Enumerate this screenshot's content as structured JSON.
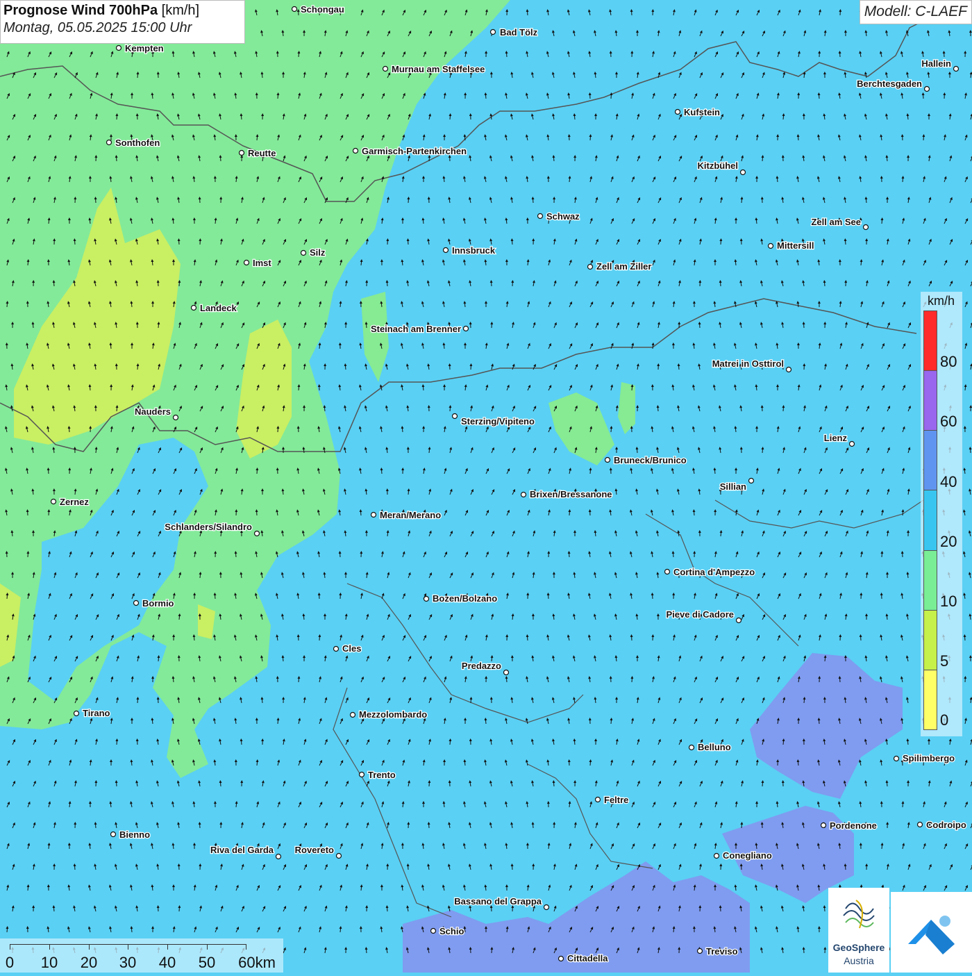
{
  "header": {
    "title_bold": "Prognose Wind 700hPa",
    "title_unit": "[km/h]",
    "datetime": "Montag, 05.05.2025 15:00 Uhr"
  },
  "model_label": "Modell: C-LAEF",
  "legend": {
    "unit": "km/h",
    "ticks": [
      "80",
      "60",
      "40",
      "20",
      "10",
      "5",
      "0"
    ],
    "colors": [
      "#ff2b2b",
      "#9966ee",
      "#5f95f0",
      "#38c6f0",
      "#79ee95",
      "#c6f04a",
      "#ffff66"
    ]
  },
  "scalebar": {
    "labels": [
      "0",
      "10",
      "20",
      "30",
      "40",
      "50",
      "60km"
    ]
  },
  "cities": [
    {
      "name": "Schongau"
    },
    {
      "name": "Bad Tölz"
    },
    {
      "name": "Kempten"
    },
    {
      "name": "Murnau am Staffelsee"
    },
    {
      "name": "Hallein"
    },
    {
      "name": "Berchtesgaden"
    },
    {
      "name": "Kufstein"
    },
    {
      "name": "Sonthofen"
    },
    {
      "name": "Reutte"
    },
    {
      "name": "Garmisch-Partenkirchen"
    },
    {
      "name": "Kitzbühel"
    },
    {
      "name": "Schwaz"
    },
    {
      "name": "Zell am See"
    },
    {
      "name": "Innsbruck"
    },
    {
      "name": "Mittersill"
    },
    {
      "name": "Silz"
    },
    {
      "name": "Imst"
    },
    {
      "name": "Zell am Ziller"
    },
    {
      "name": "Landeck"
    },
    {
      "name": "Steinach am Brenner"
    },
    {
      "name": "Matrei in Osttirol"
    },
    {
      "name": "Nauders"
    },
    {
      "name": "Sterzing/Vipiteno"
    },
    {
      "name": "Lienz"
    },
    {
      "name": "Bruneck/Brunico"
    },
    {
      "name": "Sillian"
    },
    {
      "name": "Brixen/Bressanone"
    },
    {
      "name": "Zernez"
    },
    {
      "name": "Meran/Merano"
    },
    {
      "name": "Schlanders/Silandro"
    },
    {
      "name": "Cortina d'Ampezzo"
    },
    {
      "name": "Bozen/Bolzano"
    },
    {
      "name": "Bormio"
    },
    {
      "name": "Pieve di Cadore"
    },
    {
      "name": "Cles"
    },
    {
      "name": "Predazzo"
    },
    {
      "name": "Tirano"
    },
    {
      "name": "Mezzolombardo"
    },
    {
      "name": "Belluno"
    },
    {
      "name": "Spilimbergo"
    },
    {
      "name": "Trento"
    },
    {
      "name": "Feltre"
    },
    {
      "name": "Pordenone"
    },
    {
      "name": "Codroipo"
    },
    {
      "name": "Bienno"
    },
    {
      "name": "Riva del Garda"
    },
    {
      "name": "Rovereto"
    },
    {
      "name": "Conegliano"
    },
    {
      "name": "Bassano del Grappa"
    },
    {
      "name": "Schio"
    },
    {
      "name": "Treviso"
    },
    {
      "name": "Cittadella"
    }
  ],
  "logos": {
    "geosphere_line1": "GeoSphere",
    "geosphere_line2": "Austria"
  }
}
